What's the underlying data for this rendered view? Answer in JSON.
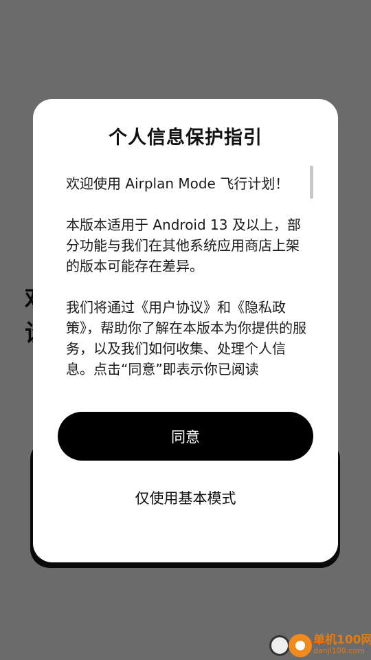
{
  "background": {
    "heading_fragment": "欢迎\n设"
  },
  "dialog": {
    "title": "个人信息保护指引",
    "paragraphs": [
      "欢迎使用 Airplan Mode 飞行计划！",
      "本版本适用于 Android 13 及以上，部分功能与我们在其他系统应用商店上架的版本可能存在差异。",
      "我们将通过《用户协议》和《隐私政策》，帮助你了解在本版本为你提供的服务，以及我们如何收集、处理个人信息。点击“同意”即表示你已阅读"
    ],
    "agree_label": "同意",
    "basic_mode_label": "仅使用基本模式"
  },
  "watermark": {
    "site_name": "单机100网",
    "site_url": "danji100.com"
  },
  "colors": {
    "overlay": "#6b6b6b",
    "dialog_bg": "#ffffff",
    "primary_button": "#000000",
    "watermark_orange": "#e67a10"
  }
}
